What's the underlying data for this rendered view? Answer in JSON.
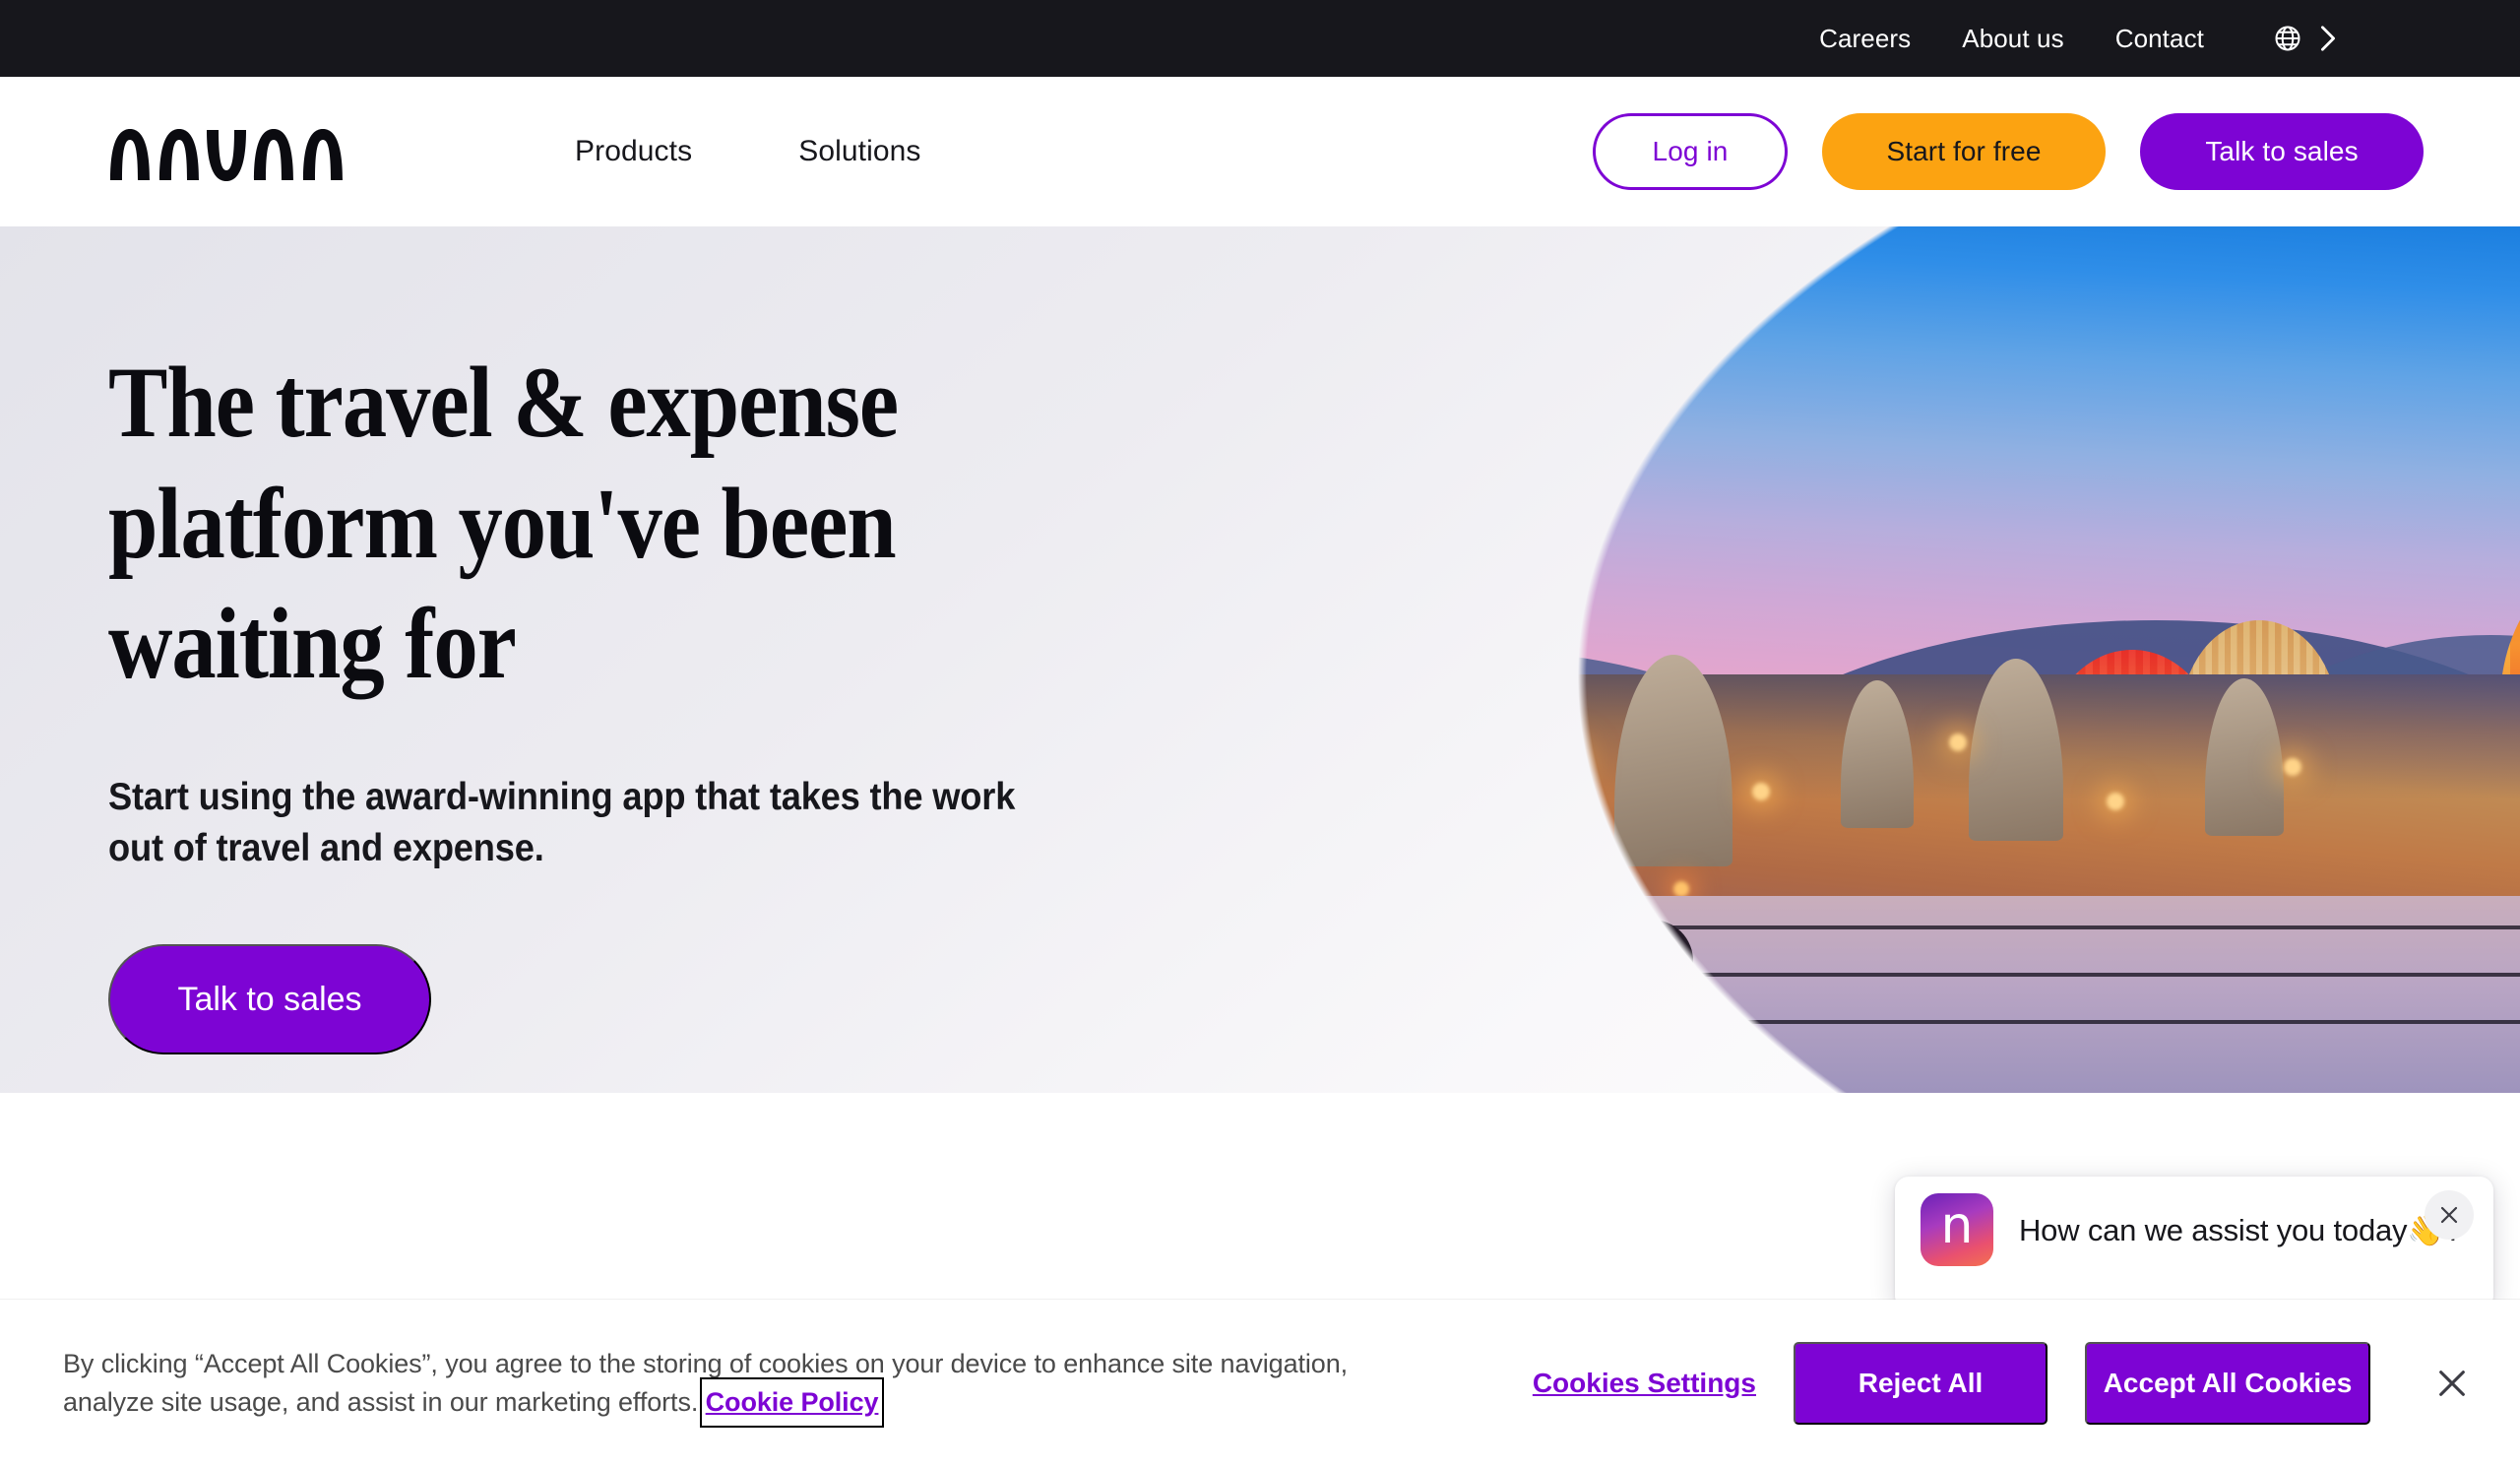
{
  "topbar": {
    "links": [
      {
        "label": "Careers"
      },
      {
        "label": "About us"
      },
      {
        "label": "Contact"
      }
    ],
    "language_icon": "globe-icon",
    "language_chevron": "chevron-right-icon"
  },
  "header": {
    "logo_text": "navan",
    "nav": [
      {
        "label": "Products"
      },
      {
        "label": "Solutions"
      }
    ],
    "ctas": {
      "login": "Log in",
      "start_free": "Start for free",
      "talk_to_sales": "Talk to sales"
    }
  },
  "hero": {
    "heading": "The travel & expense platform you've been waiting for",
    "subheading": "Start using the award-winning app that takes the work out of travel and expense.",
    "cta": "Talk to sales",
    "image_alt": "Cappadocia town at sunset with hot air balloons"
  },
  "chat": {
    "avatar_letter": "n",
    "message": "How can we assist you today👋?",
    "close_icon": "close-icon"
  },
  "cookie_banner": {
    "text_part1": "By clicking “Accept All Cookies”, you agree to the storing of cookies on your device to enhance site navigation, analyze site usage, and assist in our marketing efforts.",
    "policy_link": "Cookie Policy",
    "settings_label": "Cookies Settings",
    "reject_label": "Reject All",
    "accept_label": "Accept All Cookies",
    "close_icon": "close-icon"
  },
  "colors": {
    "topbar_bg": "#17171c",
    "brand_purple": "#7d04d4",
    "accent_orange": "#fca311",
    "text_dark": "#17171c",
    "cookie_text": "#4a4a4a"
  }
}
